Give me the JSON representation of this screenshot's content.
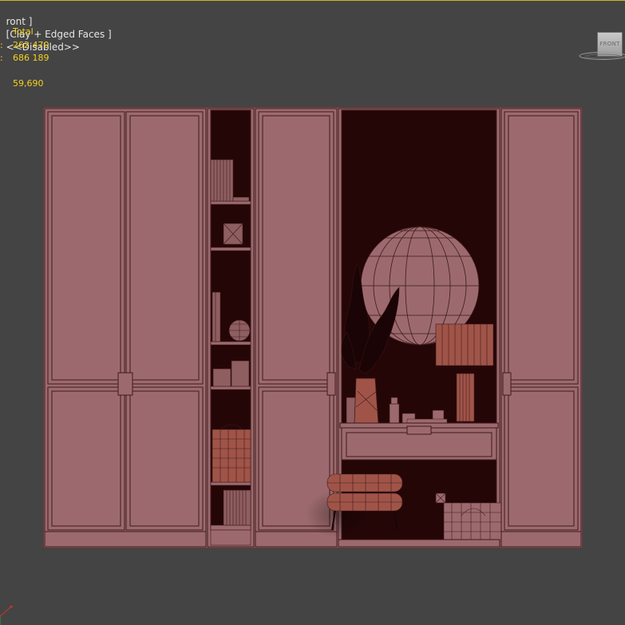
{
  "viewport": {
    "label_prefix": "ront ]",
    "label_mode": "[Clay + Edged Faces ]",
    "label_disabled": "<<Disabled>>",
    "navcube_face": "FRONT"
  },
  "stats": {
    "total_label": "Total",
    "polys_prefix": ":",
    "polys_value": "262 470",
    "verts_prefix": ":",
    "verts_value": "686 189",
    "fps_value": "59,690"
  },
  "colors": {
    "background": "#444444",
    "clay": "#9c6a6e",
    "edge": "#3e1a1c",
    "niche": "#250607",
    "stats_text": "#f5d21e",
    "active_border": "#c8b820"
  }
}
